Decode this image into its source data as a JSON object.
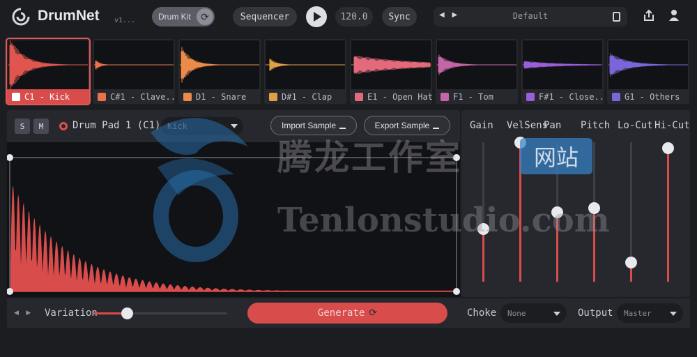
{
  "app": {
    "name": "DrumNet",
    "version": "v1..."
  },
  "toolbar": {
    "drumkit_label": "Drum Kit",
    "sequencer_label": "Sequencer",
    "tempo": "120.0",
    "sync_label": "Sync",
    "preset_name": "Default",
    "preset_nav": "◀ ▶"
  },
  "pads": [
    {
      "label": "C1 - Kick",
      "icon": "kick-icon",
      "color": "#e0564f"
    },
    {
      "label": "C#1 - Clave...",
      "icon": "clave-icon",
      "color": "#e8734a"
    },
    {
      "label": "D1 - Snare",
      "icon": "snare-icon",
      "color": "#ec8a4a"
    },
    {
      "label": "D#1 - Clap",
      "icon": "clap-icon",
      "color": "#e0a048"
    },
    {
      "label": "E1 - Open Hat",
      "icon": "open-hat-icon",
      "color": "#e36a7a"
    },
    {
      "label": "F1 - Tom",
      "icon": "tom-icon",
      "color": "#c466a6"
    },
    {
      "label": "F#1 - Close...",
      "icon": "closed-hat-icon",
      "color": "#9a5ed8"
    },
    {
      "label": "G1 - Others",
      "icon": "others-icon",
      "color": "#7a66d8"
    }
  ],
  "editor": {
    "solo_label": "S",
    "mute_label": "M",
    "pad_title": "Drum Pad 1 (C1)",
    "sample_value": "Kick",
    "import_label": "Import Sample",
    "export_label": "Export Sample"
  },
  "mixer": {
    "channels": [
      {
        "label": "Gain",
        "level": 0.38
      },
      {
        "label": "VelSens",
        "level": 1.0
      },
      {
        "label": "Pan",
        "level": 0.5
      },
      {
        "label": "Pitch",
        "level": 0.53
      },
      {
        "label": "Lo-Cut",
        "level": 0.14
      },
      {
        "label": "Hi-Cut",
        "level": 0.96
      }
    ]
  },
  "bottom": {
    "nav": "◀ ▶",
    "variation_label": "Variation",
    "variation_level": 0.25,
    "generate_label": "Generate",
    "choke_label": "Choke",
    "choke_value": "None",
    "output_label": "Output",
    "output_value": "Master"
  },
  "watermark": {
    "cn_text": "腾龙工作室",
    "site_badge": "网站",
    "url": "Tenlonstudio.com"
  },
  "colors": {
    "accent": "#d94c4c",
    "background": "#1c1d21",
    "panel": "#26282d"
  }
}
